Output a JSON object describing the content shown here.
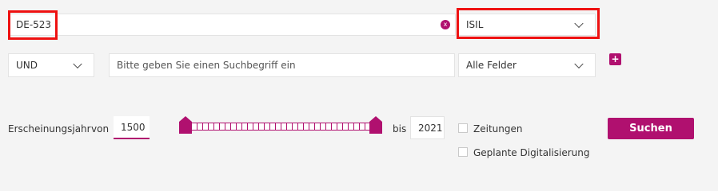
{
  "row1": {
    "query_value": "DE-523",
    "clear_icon": "x-circle-icon",
    "clear_glyph": "x",
    "field_select": "ISIL"
  },
  "row2": {
    "operator_select": "UND",
    "query_placeholder": "Bitte geben Sie einen Suchbegriff ein",
    "field_select": "Alle Felder",
    "add_icon": "plus-icon",
    "add_glyph": "+"
  },
  "filters": {
    "year_label": "Erscheinungsjahr",
    "from_label": "von",
    "from_value": "1500",
    "to_label": "bis",
    "to_value": "2021",
    "checkbox_newspapers": "Zeitungen",
    "checkbox_planned_digitization": "Geplante Digitalisierung",
    "search_button": "Suchen"
  },
  "colors": {
    "accent": "#b0106f",
    "highlight": "#ee1111",
    "background": "#f4f4f4"
  }
}
